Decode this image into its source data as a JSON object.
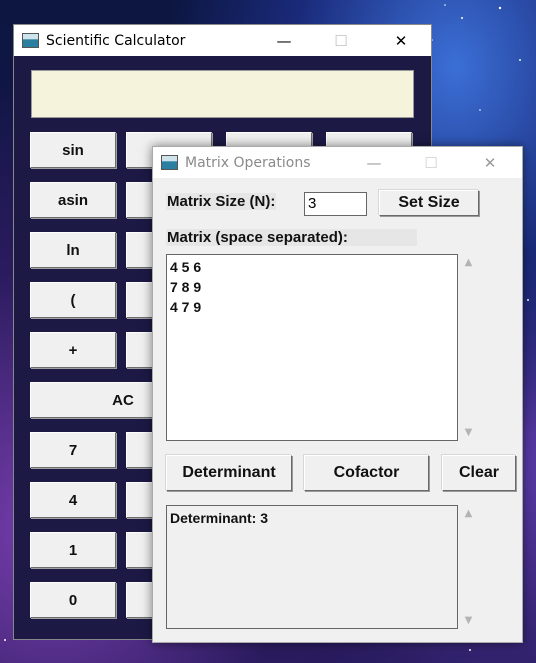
{
  "calculator": {
    "title": "Scientific Calculator",
    "minimize": "—",
    "maximize": "☐",
    "close": "✕",
    "display_value": "",
    "buttons": [
      "sin",
      "asin",
      "ln",
      "(",
      "+",
      "AC",
      "7",
      "4",
      "1",
      "0"
    ]
  },
  "matrix": {
    "title": "Matrix Operations",
    "minimize": "—",
    "maximize": "☐",
    "close": "✕",
    "size_label": "Matrix Size (N):",
    "size_value": "3",
    "set_size_label": "Set Size",
    "matrix_label": "Matrix (space separated):",
    "matrix_text": "4 5 6\n7 8 9\n4 7 9",
    "determinant_label": "Determinant",
    "cofactor_label": "Cofactor",
    "clear_label": "Clear",
    "result_text": "Determinant: 3",
    "scroll_up": "▲",
    "scroll_down": "▼"
  }
}
